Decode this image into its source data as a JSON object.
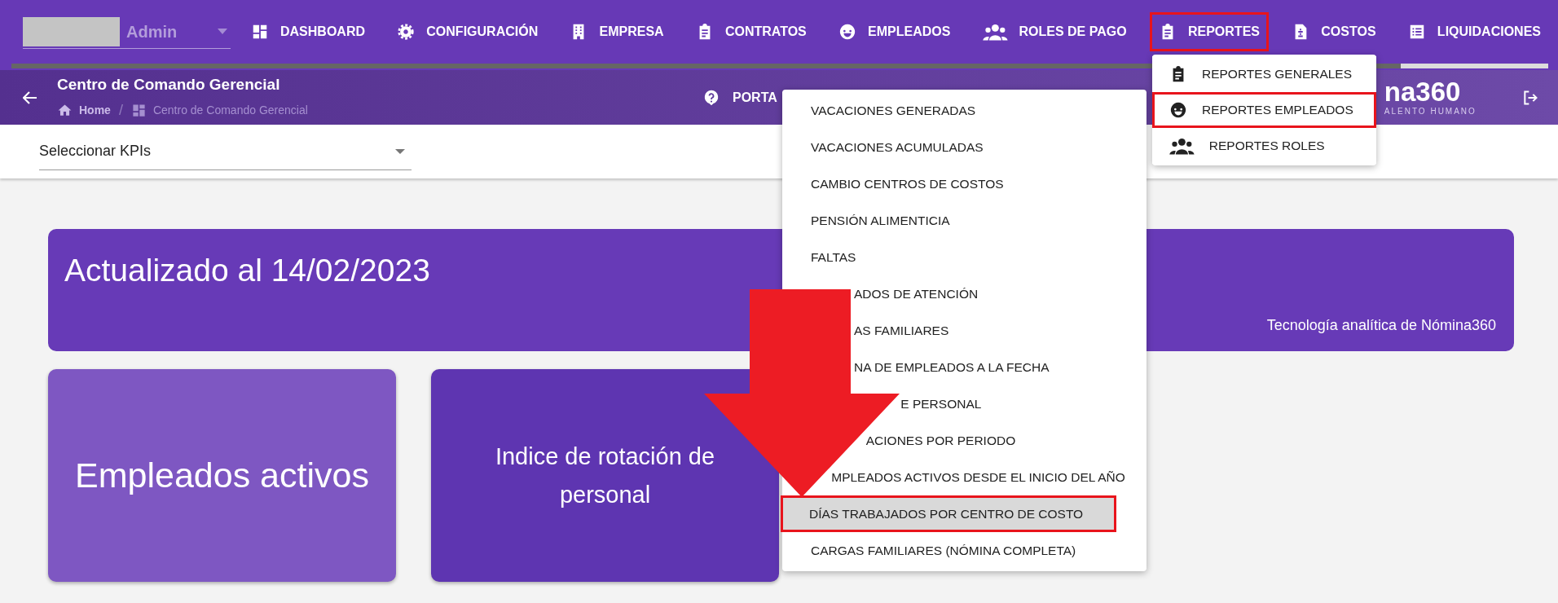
{
  "header": {
    "user": {
      "name": "Admin"
    },
    "nav": [
      {
        "label": "DASHBOARD",
        "kind": "dashboard",
        "highlighted": false
      },
      {
        "label": "CONFIGURACIÓN",
        "kind": "gear",
        "highlighted": false
      },
      {
        "label": "EMPRESA",
        "kind": "building",
        "highlighted": false
      },
      {
        "label": "CONTRATOS",
        "kind": "clipboard",
        "highlighted": false
      },
      {
        "label": "EMPLEADOS",
        "kind": "face",
        "highlighted": false
      },
      {
        "label": "ROLES DE PAGO",
        "kind": "group",
        "highlighted": false
      },
      {
        "label": "REPORTES",
        "kind": "clipboard",
        "highlighted": true
      },
      {
        "label": "COSTOS",
        "kind": "invoice",
        "highlighted": false
      },
      {
        "label": "LIQUIDACIONES",
        "kind": "list",
        "highlighted": false
      }
    ]
  },
  "subheader": {
    "title": "Centro de Comando Gerencial",
    "breadcrumb": [
      {
        "label": "Home",
        "kind": "home"
      },
      {
        "label": "Centro de Comando Gerencial",
        "kind": "dashboard"
      }
    ],
    "breadcrumb_separator": "/",
    "portal_link": "PORTA",
    "logo": {
      "name": "na360",
      "tagline": "ALENTO HUMANO"
    }
  },
  "kpi_select": {
    "label": "Seleccionar KPIs"
  },
  "banner": {
    "title": "Actualizado al 14/02/2023",
    "footer": "Tecnología analítica de Nómina360"
  },
  "kpi_cards": [
    {
      "label": "Empleados activos",
      "color": "#7e57c2"
    },
    {
      "label": "Indice de rotación de personal",
      "color": "#5e35b1"
    }
  ],
  "reportes_menu": {
    "items": [
      {
        "label": "REPORTES GENERALES",
        "kind": "clipboard",
        "highlighted": false
      },
      {
        "label": "REPORTES EMPLEADOS",
        "kind": "face",
        "highlighted": true
      },
      {
        "label": "REPORTES ROLES",
        "kind": "group",
        "highlighted": false
      }
    ]
  },
  "empleados_menu": {
    "items": [
      {
        "label": "VACACIONES GENERADAS",
        "selected": false,
        "highlighted": false
      },
      {
        "label": "VACACIONES ACUMULADAS",
        "selected": false,
        "highlighted": false
      },
      {
        "label": "CAMBIO CENTROS DE COSTOS",
        "selected": false,
        "highlighted": false
      },
      {
        "label": "PENSIÓN ALIMENTICIA",
        "selected": false,
        "highlighted": false
      },
      {
        "label": "FALTAS",
        "selected": false,
        "highlighted": false
      },
      {
        "label": "ADOS DE ATENCIÓN",
        "selected": false,
        "highlighted": false
      },
      {
        "label": "AS FAMILIARES",
        "selected": false,
        "highlighted": false
      },
      {
        "label": "NA DE EMPLEADOS A LA FECHA",
        "selected": false,
        "highlighted": false
      },
      {
        "label": "E PERSONAL",
        "selected": false,
        "highlighted": false
      },
      {
        "label": "ACIONES POR PERIODO",
        "selected": false,
        "highlighted": false
      },
      {
        "label": "MPLEADOS ACTIVOS DESDE EL INICIO DEL AÑO",
        "selected": false,
        "highlighted": false
      },
      {
        "label": "DÍAS TRABAJADOS POR CENTRO DE COSTO",
        "selected": true,
        "highlighted": true
      },
      {
        "label": "CARGAS FAMILIARES (NÓMINA COMPLETA)",
        "selected": false,
        "highlighted": false
      }
    ]
  }
}
